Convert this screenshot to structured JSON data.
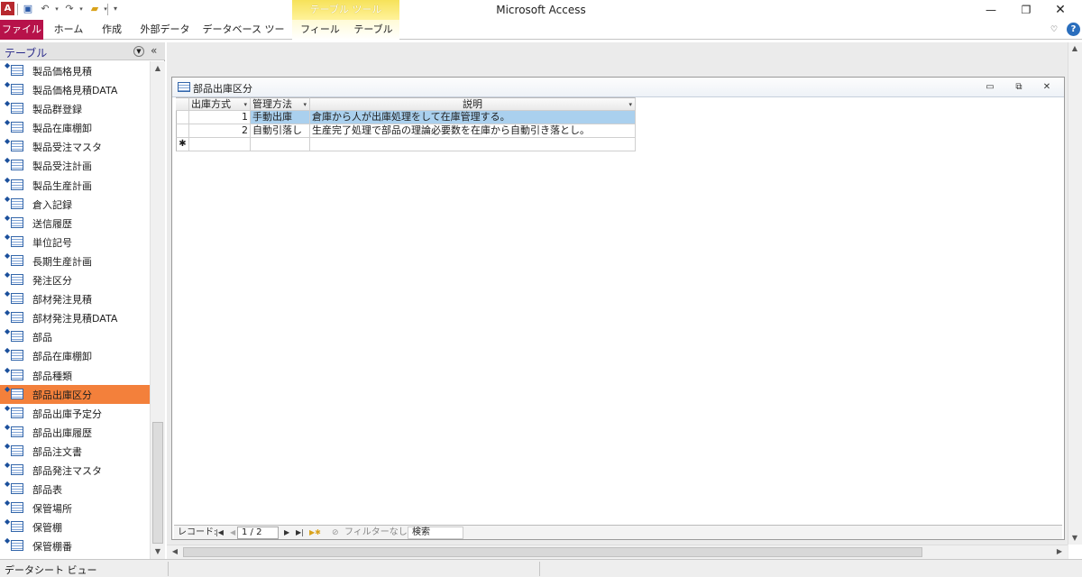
{
  "title_bar": {
    "app_icon": "A",
    "window_title": "Microsoft Access",
    "contextual_group": "テーブル ツール",
    "qat_icons": [
      "save-icon",
      "undo-icon",
      "redo-icon",
      "open-folder-icon",
      "customize-qat-icon"
    ],
    "window_controls": [
      "minimize-icon",
      "restore-icon",
      "close-icon"
    ]
  },
  "ribbon": {
    "file_tab": "ファイル",
    "tabs": [
      "ホーム",
      "作成",
      "外部データ",
      "データベース ツール"
    ],
    "context_tabs": [
      "フィールド",
      "テーブル"
    ],
    "help": "?"
  },
  "nav_pane": {
    "title": "テーブル",
    "items": [
      "製品価格見積",
      "製品価格見積DATA",
      "製品群登録",
      "製品在庫棚卸",
      "製品受注マスタ",
      "製品受注計画",
      "製品生産計画",
      "倉入記録",
      "送信履歴",
      "単位記号",
      "長期生産計画",
      "発注区分",
      "部材発注見積",
      "部材発注見積DATA",
      "部品",
      "部品在庫棚卸",
      "部品種類",
      "部品出庫区分",
      "部品出庫予定分",
      "部品出庫履歴",
      "部品注文書",
      "部品発注マスタ",
      "部品表",
      "保管場所",
      "保管棚",
      "保管棚番"
    ],
    "selected_index": 17
  },
  "document": {
    "title": "部品出庫区分",
    "columns": [
      "出庫方式",
      "管理方法",
      "説明"
    ],
    "rows": [
      [
        "1",
        "手動出庫",
        "倉庫から人が出庫処理をして在庫管理する。"
      ],
      [
        "2",
        "自動引落し",
        "生産完了処理で部品の理論必要数を在庫から自動引き落とし。"
      ]
    ],
    "new_row_marker": "✱",
    "record_nav": {
      "label": "レコード:",
      "position": "1 / 2",
      "filter": "フィルターなし",
      "search": "検索"
    }
  },
  "status_bar": {
    "view": "データシート ビュー"
  },
  "colors": {
    "file_tab": "#b7124a",
    "selected_nav": "#f3803b",
    "selected_row": "#aad0ee",
    "contextual": "#f6e25a"
  }
}
